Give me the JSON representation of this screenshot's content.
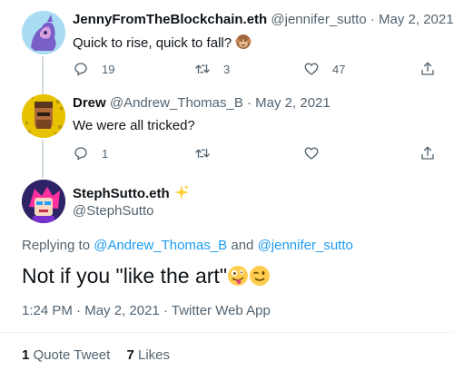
{
  "tweets": [
    {
      "display_name": "JennyFromTheBlockchain.eth",
      "handle": "@jennifer_sutto",
      "sep": "·",
      "date": "May 2, 2021",
      "text": "Quick to rise, quick to fall?",
      "emoji_icon": "monkey-face",
      "replies": "19",
      "retweets": "3",
      "likes": "47"
    },
    {
      "display_name": "Drew",
      "handle": "@Andrew_Thomas_B",
      "sep": "·",
      "date": "May 2, 2021",
      "text": "We were all tricked?",
      "replies": "1"
    }
  ],
  "main_tweet": {
    "display_name": "StephSutto.eth",
    "name_emoji_icon": "sparkles",
    "handle": "@StephSutto",
    "replying_prefix": "Replying to",
    "reply_to_1": "@Andrew_Thomas_B",
    "reply_and": "and",
    "reply_to_2": "@jennifer_sutto",
    "text": "Not if you \"like the art\"",
    "emoji_icons": [
      "zany-face",
      "winking-face"
    ],
    "time": "1:24 PM",
    "sep": "·",
    "date": "May 2, 2021",
    "sep2": "·",
    "source": "Twitter Web App",
    "quote_count": "1",
    "quote_label": "Quote Tweet",
    "like_count": "7",
    "like_label": "Likes"
  },
  "colors": {
    "text": "#0f1419",
    "muted": "#536471",
    "link": "#1d9bf0",
    "thread_line": "#cfd9de",
    "divider": "#eff3f4",
    "sparkles": "#ffcc32"
  }
}
